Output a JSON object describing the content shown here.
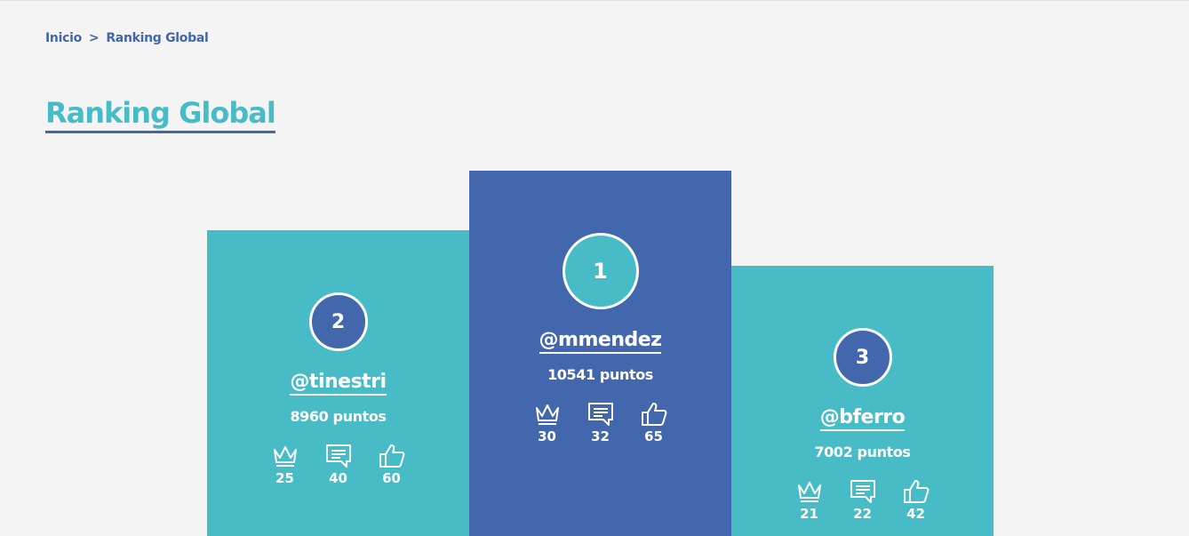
{
  "breadcrumb": {
    "home": "Inicio",
    "separator": ">",
    "current": "Ranking Global"
  },
  "page_title": "Ranking Global",
  "colors": {
    "teal": "#47bcc7",
    "blue": "#4267ad",
    "background": "#f4f4f4"
  },
  "podium": {
    "first": {
      "rank": "1",
      "username": "@mmendez",
      "points": "10541 puntos",
      "crowns": "30",
      "comments": "32",
      "likes": "65"
    },
    "second": {
      "rank": "2",
      "username": "@tinestri",
      "points": "8960 puntos",
      "crowns": "25",
      "comments": "40",
      "likes": "60"
    },
    "third": {
      "rank": "3",
      "username": "@bferro",
      "points": "7002 puntos",
      "crowns": "21",
      "comments": "22",
      "likes": "42"
    }
  },
  "icons": {
    "crowns": "crown-icon",
    "comments": "comment-icon",
    "likes": "thumbs-up-icon"
  }
}
